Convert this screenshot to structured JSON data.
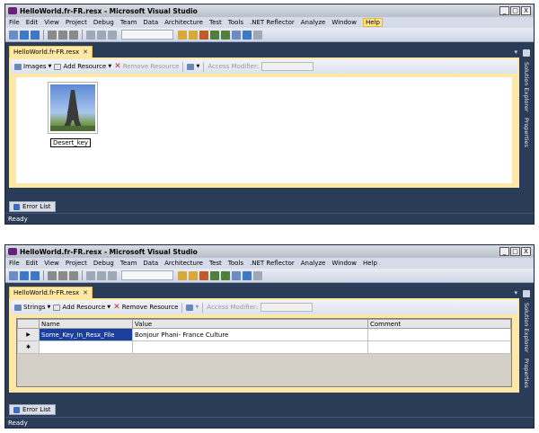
{
  "window1": {
    "title": "HelloWorld.fr-FR.resx - Microsoft Visual Studio",
    "controls": [
      "_",
      "□",
      "X"
    ],
    "menu": [
      "File",
      "Edit",
      "View",
      "Project",
      "Debug",
      "Team",
      "Data",
      "Architecture",
      "Test",
      "Tools",
      ".NET Reflector",
      "Analyze",
      "Window",
      "Help"
    ],
    "tab": "HelloWorld.fr-FR.resx",
    "tab_close": "✕",
    "restoolbar": {
      "view": "Images",
      "add": "Add Resource",
      "remove": "Remove Resource",
      "access": "Access Modifier:"
    },
    "resource": {
      "name": "Desert_key"
    },
    "side_tabs": [
      "Solution Explorer",
      "Properties"
    ],
    "error_list": "Error List",
    "status": "Ready"
  },
  "window2": {
    "title": "HelloWorld.fr-FR.resx - Microsoft Visual Studio",
    "controls": [
      "_",
      "□",
      "X"
    ],
    "menu": [
      "File",
      "Edit",
      "View",
      "Project",
      "Debug",
      "Team",
      "Data",
      "Architecture",
      "Test",
      "Tools",
      ".NET Reflector",
      "Analyze",
      "Window",
      "Help"
    ],
    "tab": "HelloWorld.fr-FR.resx",
    "tab_close": "✕",
    "restoolbar": {
      "view": "Strings",
      "add": "Add Resource",
      "remove": "Remove Resource",
      "access": "Access Modifier:"
    },
    "grid": {
      "columns": [
        "Name",
        "Value",
        "Comment"
      ],
      "rows": [
        {
          "marker": "▶",
          "name": "Some_Key_In_Resx_File",
          "value": "Bonjour Phani- France Culture",
          "comment": ""
        },
        {
          "marker": "✱",
          "name": "",
          "value": "",
          "comment": ""
        }
      ]
    },
    "side_tabs": [
      "Solution Explorer",
      "Properties"
    ],
    "error_list": "Error List",
    "status": "Ready"
  },
  "colors": {
    "accent": "#ffe8a6",
    "frame": "#2b3c59",
    "selection": "#1a3f9c"
  }
}
